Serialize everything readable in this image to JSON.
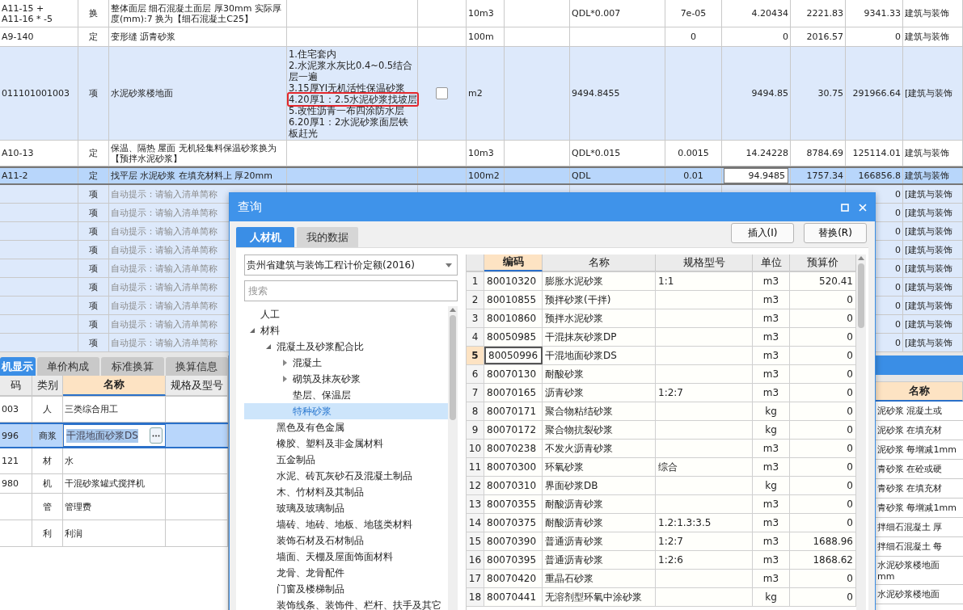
{
  "main_table": {
    "rows": [
      {
        "kind": "quota",
        "selected": false,
        "editing": false,
        "code": "A11-15 +\nA11-16 * -5",
        "type": "换",
        "name": "整体面层 细石混凝土面层 厚30mm  实际厚度(mm):7  换为【细石混凝土C25】",
        "unit": "10m3",
        "expression": "QDL*0.007",
        "content": "7e-05",
        "quantity": "4.20434",
        "price": "2221.83",
        "total": "9341.33",
        "category": "建筑与装饰"
      },
      {
        "kind": "quota",
        "selected": false,
        "editing": false,
        "code": "A9-140",
        "type": "定",
        "name": "变形缝 沥青砂浆",
        "unit": "100m",
        "content": "0",
        "quantity": "0",
        "price": "2016.57",
        "total": "0",
        "category": "建筑与装饰"
      },
      {
        "kind": "bill",
        "selected": false,
        "editing": false,
        "code": "011101001003",
        "type": "项",
        "name": "水泥砂浆楼地面",
        "features": [
          {
            "text": "1.住宅套内",
            "highlighted": false
          },
          {
            "text": "2.水泥浆水灰比0.4~0.5结合层一遍",
            "highlighted": false
          },
          {
            "text": "3.15厚YI无机活性保温砂浆",
            "highlighted": false
          },
          {
            "text": "4.20厚1：2.5水泥砂浆找坡层",
            "highlighted": true
          },
          {
            "text": "5.改性沥青一布四涂防水层",
            "highlighted": false
          },
          {
            "text": "6.20厚1：2水泥砂浆面层铁板赶光",
            "highlighted": false
          }
        ],
        "checked": false,
        "unit": "m2",
        "expression": "9494.8455",
        "quantity": "9494.85",
        "price": "30.75",
        "total": "291966.64",
        "category": "[建筑与装饰"
      },
      {
        "kind": "quota",
        "selected": false,
        "editing": false,
        "code": "A10-13",
        "type": "定",
        "name": "保温、隔热 屋面 无机轻集料保温砂浆换为【预拌水泥砂浆】",
        "unit": "10m3",
        "expression": "QDL*0.015",
        "content": "0.0015",
        "quantity": "14.24228",
        "price": "8784.69",
        "total": "125114.01",
        "category": "建筑与装饰"
      },
      {
        "kind": "quota",
        "selected": true,
        "editing": true,
        "code": "A11-2",
        "type": "定",
        "name": "找平层 水泥砂浆 在填充材料上 厚20mm",
        "unit": "100m2",
        "expression": "QDL",
        "content": "0.01",
        "quantity": "94.9485",
        "price": "1757.34",
        "total": "166856.8",
        "category": "建筑与装饰"
      },
      {
        "kind": "bill",
        "selected": false,
        "type": "项",
        "name": "自动提示：请输入清单简称",
        "placeholder": true,
        "total": "0",
        "category": "[建筑与装饰"
      },
      {
        "kind": "bill",
        "selected": false,
        "type": "项",
        "name": "自动提示：请输入清单简称",
        "placeholder": true,
        "total": "0",
        "category": "[建筑与装饰"
      },
      {
        "kind": "bill",
        "selected": false,
        "type": "项",
        "name": "自动提示：请输入清单简称",
        "placeholder": true,
        "total": "0",
        "category": "[建筑与装饰"
      },
      {
        "kind": "bill",
        "selected": false,
        "type": "项",
        "name": "自动提示：请输入清单简称",
        "placeholder": true,
        "total": "0",
        "category": "[建筑与装饰"
      },
      {
        "kind": "bill",
        "selected": false,
        "type": "项",
        "name": "自动提示：请输入清单简称",
        "placeholder": true,
        "total": "0",
        "category": "[建筑与装饰"
      },
      {
        "kind": "bill",
        "selected": false,
        "type": "项",
        "name": "自动提示：请输入清单简称",
        "placeholder": true,
        "total": "0",
        "category": "[建筑与装饰"
      },
      {
        "kind": "bill",
        "selected": false,
        "type": "项",
        "name": "自动提示：请输入清单简称",
        "placeholder": true,
        "total": "0",
        "category": "[建筑与装饰"
      },
      {
        "kind": "bill",
        "selected": false,
        "type": "项",
        "name": "自动提示：请输入清单简称",
        "placeholder": true,
        "total": "0",
        "category": "[建筑与装饰"
      },
      {
        "kind": "bill",
        "selected": false,
        "type": "项",
        "name": "自动提示：请输入清单简称",
        "placeholder": true,
        "total": "0",
        "category": "[建筑与装饰"
      }
    ]
  },
  "detail_panel": {
    "tabs": [
      {
        "label": "机显示",
        "selected": true
      },
      {
        "label": "单价构成",
        "selected": false
      },
      {
        "label": "标准换算",
        "selected": false
      },
      {
        "label": "换算信息",
        "selected": false
      }
    ],
    "columns": [
      {
        "label": "码",
        "active": false
      },
      {
        "label": "类别",
        "active": false
      },
      {
        "label": "名称",
        "active": true
      },
      {
        "label": "规格及型号",
        "active": false
      }
    ],
    "rows": [
      {
        "code": "003",
        "type": "人",
        "name": "三类综合用工",
        "selected": false
      },
      {
        "code": "996",
        "type": "商浆",
        "name": "干混地面砂浆DS",
        "selected": true
      },
      {
        "code": "121",
        "type": "材",
        "name": "水",
        "selected": false
      },
      {
        "code": "980",
        "type": "机",
        "name": "干混砂浆罐式搅拌机",
        "selected": false
      },
      {
        "type": "管",
        "name": "管理费",
        "selected": false
      },
      {
        "type": "利",
        "name": "利润",
        "selected": false
      }
    ]
  },
  "side_list": {
    "column": {
      "label": "名称",
      "active": true
    },
    "rows": [
      {
        "text": "泥砂浆 混凝土或"
      },
      {
        "text": "泥砂浆 在填充材"
      },
      {
        "text": "泥砂浆 每增减1mm"
      },
      {
        "text": "青砂浆 在砼或硬"
      },
      {
        "text": "青砂浆 在填充材"
      },
      {
        "text": "青砂浆 每增减1mm"
      },
      {
        "text": "拌细石混凝土 厚"
      },
      {
        "text": "拌细石混凝土 每"
      },
      {
        "text": "水泥砂浆楼地面",
        "text2": "mm"
      },
      {
        "text": "水泥砂浆楼地面"
      }
    ]
  },
  "dialog": {
    "title": "查询",
    "tabs": [
      {
        "label": "人材机",
        "selected": true
      },
      {
        "label": "我的数据",
        "selected": false
      }
    ],
    "buttons": [
      "插入(I)",
      "替换(R)"
    ],
    "library": "贵州省建筑与装饰工程计价定额(2016)",
    "search": {
      "placeholder": "搜索"
    },
    "tree": [
      {
        "label": "人工",
        "kind": "leaf",
        "selected": false
      },
      {
        "label": "材料",
        "kind": "branch",
        "expanded": true,
        "selected": false,
        "children": [
          {
            "label": "混凝土及砂浆配合比",
            "kind": "branch",
            "expanded": true,
            "selected": false,
            "children": [
              {
                "label": "混凝土",
                "kind": "branch",
                "expanded": false,
                "selected": false
              },
              {
                "label": "砌筑及抹灰砂浆",
                "kind": "branch",
                "expanded": false,
                "selected": false
              },
              {
                "label": "垫层、保温层",
                "kind": "leaf",
                "selected": false
              },
              {
                "label": "特种砂浆",
                "kind": "leaf",
                "selected": true
              }
            ]
          },
          {
            "label": "黑色及有色金属",
            "kind": "leaf",
            "selected": false
          },
          {
            "label": "橡胶、塑料及非金属材料",
            "kind": "leaf",
            "selected": false
          },
          {
            "label": "五金制品",
            "kind": "leaf",
            "selected": false
          },
          {
            "label": "水泥、砖瓦灰砂石及混凝土制品",
            "kind": "leaf",
            "selected": false
          },
          {
            "label": "木、竹材料及其制品",
            "kind": "leaf",
            "selected": false
          },
          {
            "label": "玻璃及玻璃制品",
            "kind": "leaf",
            "selected": false
          },
          {
            "label": "墙砖、地砖、地板、地毯类材料",
            "kind": "leaf",
            "selected": false
          },
          {
            "label": "装饰石材及石材制品",
            "kind": "leaf",
            "selected": false
          },
          {
            "label": "墙面、天棚及屋面饰面材料",
            "kind": "leaf",
            "selected": false
          },
          {
            "label": "龙骨、龙骨配件",
            "kind": "leaf",
            "selected": false
          },
          {
            "label": "门窗及楼梯制品",
            "kind": "leaf",
            "selected": false
          },
          {
            "label": "装饰线条、装饰件、栏杆、扶手及其它",
            "kind": "leaf",
            "selected": false
          }
        ]
      }
    ],
    "columns": [
      {
        "label": "编码",
        "active": true
      },
      {
        "label": "名称",
        "active": false
      },
      {
        "label": "规格型号",
        "active": false
      },
      {
        "label": "单位",
        "active": false
      },
      {
        "label": "预算价",
        "active": false
      }
    ],
    "rows": [
      {
        "no": "1",
        "code": "80010320",
        "name": "膨胀水泥砂浆",
        "spec": "1:1",
        "unit": "m3",
        "price": "520.41",
        "selected": false
      },
      {
        "no": "2",
        "code": "80010855",
        "name": "预拌砂浆(干拌)",
        "unit": "m3",
        "price": "0",
        "selected": false
      },
      {
        "no": "3",
        "code": "80010860",
        "name": "预拌水泥砂浆",
        "unit": "m3",
        "price": "0",
        "selected": false
      },
      {
        "no": "4",
        "code": "80050985",
        "name": "干混抹灰砂浆DP",
        "unit": "m3",
        "price": "0",
        "selected": false
      },
      {
        "no": "5",
        "code": "80050996",
        "name": "干混地面砂浆DS",
        "unit": "m3",
        "price": "0",
        "selected": true
      },
      {
        "no": "6",
        "code": "80070130",
        "name": "耐酸砂浆",
        "unit": "m3",
        "price": "0",
        "selected": false
      },
      {
        "no": "7",
        "code": "80070165",
        "name": "沥青砂浆",
        "spec": "1:2:7",
        "unit": "m3",
        "price": "0",
        "selected": false
      },
      {
        "no": "8",
        "code": "80070171",
        "name": "聚合物粘结砂浆",
        "unit": "kg",
        "price": "0",
        "selected": false
      },
      {
        "no": "9",
        "code": "80070172",
        "name": "聚合物抗裂砂浆",
        "unit": "kg",
        "price": "0",
        "selected": false
      },
      {
        "no": "10",
        "code": "80070238",
        "name": "不发火沥青砂浆",
        "unit": "m3",
        "price": "0",
        "selected": false
      },
      {
        "no": "11",
        "code": "80070300",
        "name": "环氧砂浆",
        "spec": "综合",
        "unit": "m3",
        "price": "0",
        "selected": false
      },
      {
        "no": "12",
        "code": "80070310",
        "name": "界面砂浆DB",
        "unit": "kg",
        "price": "0",
        "selected": false
      },
      {
        "no": "13",
        "code": "80070355",
        "name": "耐酸沥青砂浆",
        "unit": "m3",
        "price": "0",
        "selected": false
      },
      {
        "no": "14",
        "code": "80070375",
        "name": "耐酸沥青砂浆",
        "spec": "1.2:1.3:3.5",
        "unit": "m3",
        "price": "0",
        "selected": false
      },
      {
        "no": "15",
        "code": "80070390",
        "name": "普通沥青砂浆",
        "spec": "1:2:7",
        "unit": "m3",
        "price": "1688.96",
        "selected": false
      },
      {
        "no": "16",
        "code": "80070395",
        "name": "普通沥青砂浆",
        "spec": "1:2:6",
        "unit": "m3",
        "price": "1868.62",
        "selected": false
      },
      {
        "no": "17",
        "code": "80070420",
        "name": "重晶石砂浆",
        "unit": "m3",
        "price": "0",
        "selected": false
      },
      {
        "no": "18",
        "code": "80070441",
        "name": "无溶剂型环氧中涂砂浆",
        "unit": "kg",
        "price": "0",
        "selected": false
      }
    ]
  }
}
